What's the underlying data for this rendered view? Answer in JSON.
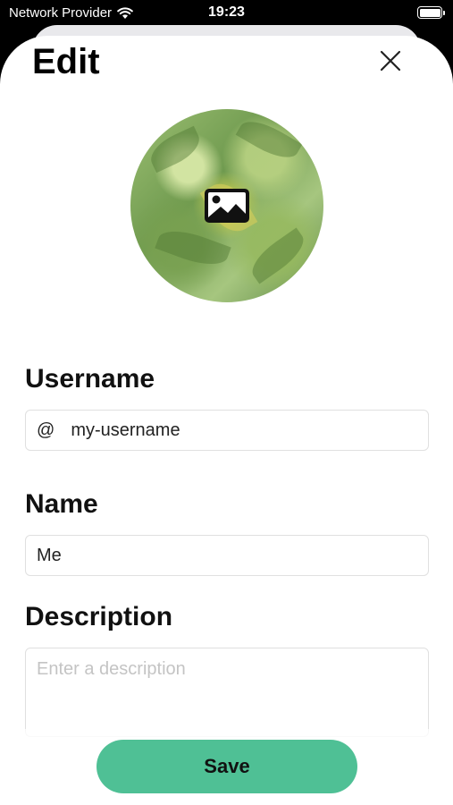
{
  "status_bar": {
    "carrier": "Network Provider",
    "time": "19:23"
  },
  "header": {
    "title": "Edit",
    "close_icon": "close-icon"
  },
  "avatar": {
    "overlay_icon": "image-icon"
  },
  "form": {
    "username_label": "Username",
    "username_prefix": "@",
    "username_value": "my-username",
    "name_label": "Name",
    "name_value": "Me",
    "description_label": "Description",
    "description_placeholder": "Enter a description",
    "description_value": ""
  },
  "actions": {
    "save_label": "Save"
  },
  "colors": {
    "accent": "#4fc095",
    "field_border": "#e0e0e0",
    "placeholder": "#c4c4c4"
  }
}
